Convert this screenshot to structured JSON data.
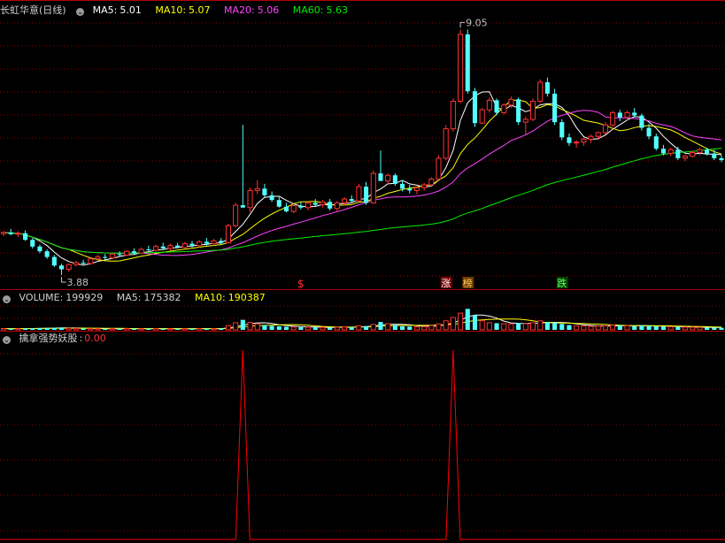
{
  "header": {
    "stock_name": "长虹华意",
    "period": "(日线)",
    "ma5_label": "MA5:",
    "ma5_value": "5.01",
    "ma10_label": "MA10:",
    "ma10_value": "5.07",
    "ma20_label": "MA20:",
    "ma20_value": "5.06",
    "ma60_label": "MA60:",
    "ma60_value": "5.63"
  },
  "volume_header": {
    "volume_label": "VOLUME:",
    "volume_value": "199929",
    "ma5_label": "MA5:",
    "ma5_value": "175382",
    "ma10_label": "MA10:",
    "ma10_value": "190387"
  },
  "indicator_header": {
    "name": "擒拿强势妖股",
    "separator": ":",
    "value": "0.00"
  },
  "annotations": {
    "high_price": "9.05",
    "low_price": "3.88",
    "dollar_mark": "$",
    "zhang_mark": "涨",
    "bang_mark": "榜",
    "die_mark": "跌"
  },
  "colors": {
    "up": "#ff3232",
    "down": "#54ffff",
    "ma5": "#ffffff",
    "ma10": "#ffff00",
    "ma20": "#ff44ff",
    "ma60": "#00ee00",
    "grid": "#8b0000",
    "signal": "#ff0000"
  },
  "chart_data": [
    {
      "type": "candlestick",
      "title": "长虹华意 (日线)",
      "ylim": [
        3.6,
        9.3
      ],
      "ohlc": [
        [
          4.75,
          4.8,
          4.7,
          4.78
        ],
        [
          4.78,
          4.85,
          4.72,
          4.74
        ],
        [
          4.74,
          4.8,
          4.68,
          4.76
        ],
        [
          4.76,
          4.82,
          4.6,
          4.62
        ],
        [
          4.62,
          4.66,
          4.44,
          4.48
        ],
        [
          4.48,
          4.52,
          4.34,
          4.38
        ],
        [
          4.38,
          4.42,
          4.22,
          4.26
        ],
        [
          4.26,
          4.3,
          4.05,
          4.08
        ],
        [
          4.08,
          4.12,
          3.88,
          4.0
        ],
        [
          4.0,
          4.12,
          3.95,
          4.1
        ],
        [
          4.1,
          4.18,
          4.06,
          4.14
        ],
        [
          4.14,
          4.2,
          4.08,
          4.12
        ],
        [
          4.12,
          4.24,
          4.1,
          4.22
        ],
        [
          4.22,
          4.3,
          4.18,
          4.26
        ],
        [
          4.26,
          4.32,
          4.2,
          4.24
        ],
        [
          4.24,
          4.34,
          4.22,
          4.32
        ],
        [
          4.32,
          4.38,
          4.26,
          4.3
        ],
        [
          4.3,
          4.4,
          4.28,
          4.38
        ],
        [
          4.38,
          4.44,
          4.3,
          4.34
        ],
        [
          4.34,
          4.46,
          4.32,
          4.42
        ],
        [
          4.42,
          4.5,
          4.38,
          4.4
        ],
        [
          4.4,
          4.52,
          4.38,
          4.48
        ],
        [
          4.48,
          4.56,
          4.4,
          4.44
        ],
        [
          4.44,
          4.54,
          4.4,
          4.5
        ],
        [
          4.5,
          4.56,
          4.44,
          4.46
        ],
        [
          4.46,
          4.58,
          4.44,
          4.54
        ],
        [
          4.54,
          4.6,
          4.46,
          4.5
        ],
        [
          4.5,
          4.62,
          4.46,
          4.58
        ],
        [
          4.58,
          4.66,
          4.5,
          4.54
        ],
        [
          4.54,
          4.64,
          4.5,
          4.6
        ],
        [
          4.6,
          4.66,
          4.52,
          4.56
        ],
        [
          4.56,
          4.96,
          4.54,
          4.92
        ],
        [
          4.92,
          5.4,
          4.88,
          5.35
        ],
        [
          5.35,
          7.04,
          5.3,
          5.3
        ],
        [
          5.3,
          5.72,
          5.2,
          5.66
        ],
        [
          5.66,
          5.88,
          5.58,
          5.7
        ],
        [
          5.7,
          5.8,
          5.52,
          5.56
        ],
        [
          5.56,
          5.64,
          5.42,
          5.46
        ],
        [
          5.46,
          5.52,
          5.3,
          5.32
        ],
        [
          5.32,
          5.4,
          5.2,
          5.22
        ],
        [
          5.22,
          5.38,
          5.18,
          5.34
        ],
        [
          5.34,
          5.42,
          5.26,
          5.3
        ],
        [
          5.3,
          5.44,
          5.24,
          5.4
        ],
        [
          5.4,
          5.48,
          5.32,
          5.36
        ],
        [
          5.36,
          5.46,
          5.3,
          5.42
        ],
        [
          5.42,
          5.48,
          5.24,
          5.28
        ],
        [
          5.28,
          5.44,
          5.22,
          5.4
        ],
        [
          5.4,
          5.52,
          5.34,
          5.48
        ],
        [
          5.48,
          5.56,
          5.4,
          5.44
        ],
        [
          5.44,
          5.8,
          5.42,
          5.74
        ],
        [
          5.74,
          5.84,
          5.36,
          5.4
        ],
        [
          5.4,
          6.08,
          5.38,
          6.02
        ],
        [
          6.02,
          6.5,
          5.96,
          5.86
        ],
        [
          5.86,
          6.02,
          5.8,
          5.98
        ],
        [
          5.98,
          6.02,
          5.76,
          5.8
        ],
        [
          5.8,
          5.88,
          5.64,
          5.7
        ],
        [
          5.7,
          5.78,
          5.6,
          5.66
        ],
        [
          5.66,
          5.74,
          5.58,
          5.72
        ],
        [
          5.72,
          5.82,
          5.66,
          5.78
        ],
        [
          5.78,
          5.94,
          5.74,
          5.9
        ],
        [
          5.9,
          6.4,
          5.88,
          6.34
        ],
        [
          6.34,
          7.04,
          6.3,
          6.96
        ],
        [
          6.96,
          7.6,
          6.9,
          7.54
        ],
        [
          7.54,
          9.05,
          7.5,
          8.95
        ],
        [
          8.95,
          9.05,
          7.7,
          7.75
        ],
        [
          7.75,
          7.82,
          7.0,
          7.08
        ],
        [
          7.08,
          7.4,
          7.06,
          7.36
        ],
        [
          7.36,
          7.62,
          7.3,
          7.56
        ],
        [
          7.56,
          7.6,
          7.24,
          7.3
        ],
        [
          7.3,
          7.5,
          7.26,
          7.46
        ],
        [
          7.46,
          7.64,
          7.4,
          7.58
        ],
        [
          7.58,
          7.62,
          7.04,
          7.1
        ],
        [
          7.1,
          7.22,
          6.84,
          7.16
        ],
        [
          7.16,
          7.6,
          7.12,
          7.54
        ],
        [
          7.54,
          8.0,
          7.5,
          7.94
        ],
        [
          7.94,
          8.04,
          7.64,
          7.7
        ],
        [
          7.7,
          7.8,
          7.04,
          7.1
        ],
        [
          7.1,
          7.16,
          6.72,
          6.78
        ],
        [
          6.78,
          6.86,
          6.6,
          6.66
        ],
        [
          6.66,
          6.72,
          6.56,
          6.68
        ],
        [
          6.68,
          6.78,
          6.6,
          6.74
        ],
        [
          6.74,
          6.84,
          6.66,
          6.8
        ],
        [
          6.8,
          6.9,
          6.72,
          6.88
        ],
        [
          6.88,
          7.1,
          6.84,
          7.04
        ],
        [
          7.04,
          7.34,
          7.0,
          7.3
        ],
        [
          7.3,
          7.36,
          7.12,
          7.2
        ],
        [
          7.2,
          7.34,
          7.14,
          7.3
        ],
        [
          7.3,
          7.4,
          7.2,
          7.24
        ],
        [
          7.24,
          7.28,
          6.92,
          6.98
        ],
        [
          6.98,
          7.06,
          6.74,
          6.8
        ],
        [
          6.8,
          6.86,
          6.5,
          6.54
        ],
        [
          6.54,
          6.62,
          6.4,
          6.44
        ],
        [
          6.44,
          6.56,
          6.38,
          6.52
        ],
        [
          6.52,
          6.58,
          6.3,
          6.34
        ],
        [
          6.34,
          6.42,
          6.28,
          6.38
        ],
        [
          6.38,
          6.5,
          6.36,
          6.46
        ],
        [
          6.46,
          6.56,
          6.4,
          6.52
        ],
        [
          6.52,
          6.56,
          6.4,
          6.44
        ],
        [
          6.44,
          6.52,
          6.3,
          6.34
        ],
        [
          6.34,
          6.4,
          6.26,
          6.3
        ]
      ]
    },
    {
      "type": "bar",
      "title": "VOLUME",
      "ylim": [
        0,
        1000
      ],
      "values": [
        55,
        50,
        48,
        60,
        70,
        75,
        80,
        90,
        95,
        70,
        60,
        55,
        50,
        48,
        45,
        50,
        52,
        55,
        50,
        48,
        52,
        55,
        50,
        48,
        45,
        50,
        52,
        55,
        50,
        48,
        60,
        180,
        300,
        420,
        310,
        250,
        200,
        170,
        150,
        130,
        120,
        110,
        115,
        110,
        105,
        100,
        110,
        120,
        115,
        170,
        160,
        230,
        330,
        260,
        200,
        150,
        140,
        130,
        135,
        180,
        250,
        380,
        520,
        700,
        880,
        620,
        380,
        300,
        280,
        260,
        250,
        280,
        260,
        300,
        380,
        330,
        300,
        250,
        200,
        170,
        160,
        150,
        160,
        170,
        200,
        190,
        170,
        160,
        180,
        170,
        150,
        140,
        130,
        120,
        115,
        110,
        105,
        100,
        95,
        90
      ]
    },
    {
      "type": "line",
      "title": "擒拿强势妖股",
      "ylim": [
        0,
        1
      ],
      "spikes_at_candle_index": [
        33,
        62
      ]
    }
  ]
}
